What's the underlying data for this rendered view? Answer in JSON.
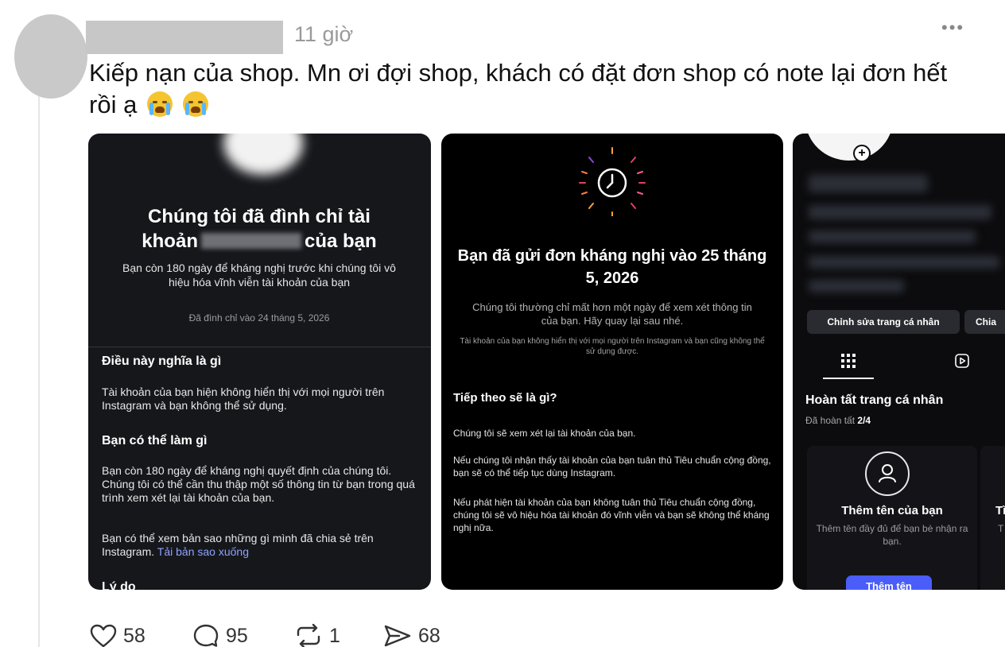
{
  "post": {
    "time": "11 giờ",
    "more": "•••",
    "caption": "Kiếp nạn của shop. Mn ơi đợi shop, khách có đặt đơn shop có note lại đơn hết rồi ạ",
    "emojis": [
      "loudly-crying-face-emoji",
      "loudly-crying-face-emoji"
    ]
  },
  "card1": {
    "title_line1": "Chúng tôi đã đình chỉ tài",
    "title_line2_start": "khoản",
    "title_line2_end": "của bạn",
    "subtitle": "Bạn còn 180 ngày để kháng nghị trước khi chúng tôi vô hiệu hóa vĩnh viễn tài khoản của bạn",
    "date": "Đã đình chỉ vào 24 tháng 5, 2026",
    "heading1": "Điều này nghĩa là gì",
    "para1": "Tài khoản của bạn hiện không hiển thị với mọi người trên Instagram và bạn không thể sử dụng.",
    "heading2": "Bạn có thể làm gì",
    "para2": "Bạn còn 180 ngày để kháng nghị quyết định của chúng tôi. Chúng tôi có thể cần thu thập một số thông tin từ bạn trong quá trình xem xét lại tài khoản của bạn.",
    "para3": "Bạn có thể xem bản sao những gì mình đã chia sẻ trên Instagram.",
    "link": "Tải bản sao xuống",
    "heading3": "Lý do"
  },
  "card2": {
    "title": "Bạn đã gửi đơn kháng nghị vào 25 tháng 5, 2026",
    "subtitle": "Chúng tôi thường chỉ mất hơn một ngày để xem xét thông tin của bạn. Hãy quay lại sau nhé.",
    "small": "Tài khoản của bạn không hiển thị với mọi người trên Instagram và bạn cũng không thể sử dụng được.",
    "heading": "Tiếp theo sẽ là gì?",
    "para1": "Chúng tôi sẽ xem xét lại tài khoản của bạn.",
    "para2": "Nếu chúng tôi nhận thấy tài khoản của bạn tuân thủ Tiêu chuẩn cộng đồng, bạn sẽ có thể tiếp tục dùng Instagram.",
    "para3": "Nếu phát hiện tài khoản của bạn không tuân thủ Tiêu chuẩn cộng đồng, chúng tôi sẽ vô hiệu hóa tài khoản đó vĩnh viễn và bạn sẽ không thể kháng nghị nữa."
  },
  "card3": {
    "edit_button": "Chỉnh sửa trang cá nhân",
    "share_button": "Chia",
    "complete_title": "Hoàn tất trang cá nhân",
    "progress_label": "Đã hoàn tất",
    "progress_value": "2/4",
    "add_name_title": "Thêm tên của bạn",
    "add_name_desc": "Thêm tên đầy đủ để bạn bè nhận ra bạn.",
    "add_name_button": "Thêm tên",
    "side_title": "Tì",
    "side_desc": "T"
  },
  "actions": {
    "likes": "58",
    "comments": "95",
    "reposts": "1",
    "shares": "68"
  },
  "colors": {
    "link": "#8fa2ff",
    "primary_button": "#4a5df9"
  }
}
